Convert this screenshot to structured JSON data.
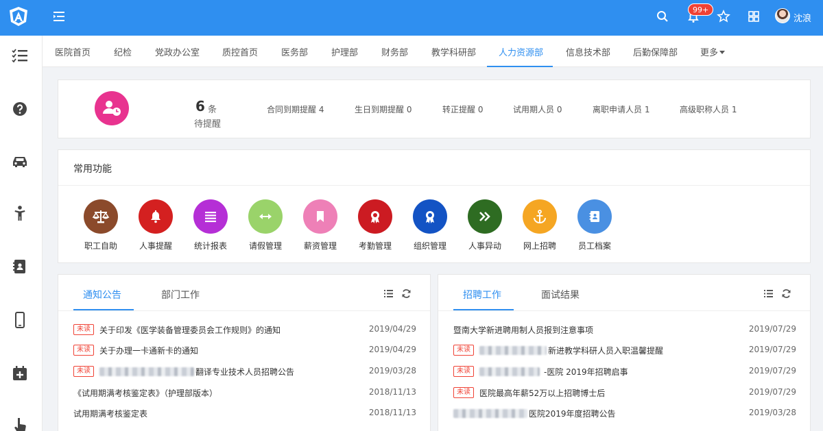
{
  "topbar": {
    "badge": "99+",
    "user": "沈浪",
    "colors": {
      "primary": "#2f8ff0"
    }
  },
  "tabs": [
    "医院首页",
    "纪检",
    "党政办公室",
    "质控首页",
    "医务部",
    "护理部",
    "财务部",
    "教学科研部",
    "人力资源部",
    "信息技术部",
    "后勤保障部",
    "更多"
  ],
  "active_tab": "人力资源部",
  "reminder": {
    "count": "6",
    "unit": "条",
    "label": "待提醒",
    "items": [
      "合同到期提醒 4",
      "生日到期提醒 0",
      "转正提醒 0",
      "试用期人员 0",
      "离职申请人员 1",
      "高级职称人员 1"
    ]
  },
  "functions": {
    "title": "常用功能",
    "items": [
      {
        "label": "职工自助",
        "color": "#8b4a2b",
        "icon": "scale-icon"
      },
      {
        "label": "人事提醒",
        "color": "#d42020",
        "icon": "bell-icon"
      },
      {
        "label": "统计报表",
        "color": "#b52fd6",
        "icon": "list-icon"
      },
      {
        "label": "请假管理",
        "color": "#9ad36a",
        "icon": "arrows-icon"
      },
      {
        "label": "薪资管理",
        "color": "#ee80b7",
        "icon": "bookmark-icon"
      },
      {
        "label": "考勤管理",
        "color": "#cc1b22",
        "icon": "award-icon"
      },
      {
        "label": "组织管理",
        "color": "#1353c4",
        "icon": "award-icon"
      },
      {
        "label": "人事异动",
        "color": "#2e6c22",
        "icon": "forward-icon"
      },
      {
        "label": "网上招聘",
        "color": "#f5a623",
        "icon": "anchor-icon"
      },
      {
        "label": "员工档案",
        "color": "#4a90e2",
        "icon": "contact-book-icon"
      }
    ]
  },
  "notice": {
    "tabs": [
      "通知公告",
      "部门工作"
    ],
    "unread_label": "未读",
    "rows": [
      {
        "unread": true,
        "text": "关于印发《医学装备管理委员会工作规则》的通知",
        "date": "2019/04/29"
      },
      {
        "unread": true,
        "text": "关于办理一卡通新卡的通知",
        "date": "2019/04/29"
      },
      {
        "unread": true,
        "text": "翻译专业技术人员招聘公告",
        "date": "2019/03/28",
        "blur": true
      },
      {
        "unread": false,
        "text": "《试用期满考核鉴定表》（护理部版本）",
        "date": "2018/11/13"
      },
      {
        "unread": false,
        "text": "试用期满考核鉴定表",
        "date": "2018/11/13"
      }
    ]
  },
  "recruit": {
    "tabs": [
      "招聘工作",
      "面试结果"
    ],
    "rows": [
      {
        "unread": false,
        "text": "暨南大学新进聘用制人员报到注意事项",
        "date": "2019/07/29"
      },
      {
        "unread": true,
        "text": "新进教学科研人员入职温馨提醒",
        "date": "2019/07/29",
        "blur": true
      },
      {
        "unread": true,
        "text": "-医院 2019年招聘启事",
        "date": "2019/07/29",
        "blur": true
      },
      {
        "unread": true,
        "text": "医院最高年薪52万以上招聘博士后",
        "date": "2019/07/29"
      },
      {
        "unread": false,
        "text": "医院2019年度招聘公告",
        "date": "2019/03/28",
        "blur": true
      }
    ]
  }
}
